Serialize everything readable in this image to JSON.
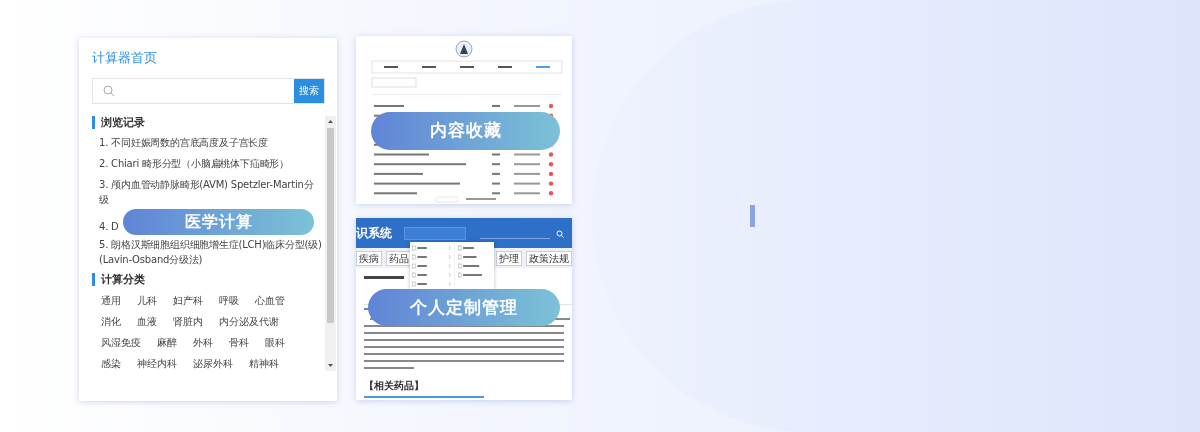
{
  "calculator_panel": {
    "title": "计算器首页",
    "search": {
      "button": "搜索"
    },
    "history": {
      "heading": "浏览记录",
      "items": [
        "1. 不同妊娠周数的宫底高度及子宫长度",
        "2. Chiari 畸形分型（小脑扁桃体下疝畸形）",
        "3. 颅内血管动静脉畸形(AVM) Spetzler-Martin分级",
        "4. D",
        "5. 朗格汉斯细胞组织细胞增生症(LCH)临床分型(级)(Lavin-Osband分级法)"
      ]
    },
    "categories": {
      "heading": "计算分类",
      "rows": [
        [
          "通用",
          "儿科",
          "妇产科",
          "呼吸",
          "心血管"
        ],
        [
          "消化",
          "血液",
          "肾脏内",
          "内分泌及代谢"
        ],
        [
          "风湿免疫",
          "麻醉",
          "外科",
          "骨科",
          "眼科"
        ],
        [
          "感染",
          "神经内科",
          "泌尿外科",
          "精神科"
        ]
      ]
    },
    "overlay_label": "医学计算"
  },
  "favorites_panel": {
    "overlay_label": "内容收藏"
  },
  "custom_panel": {
    "header_title": "识系统",
    "nav_left": [
      "疾病",
      "药品"
    ],
    "nav_right": [
      "护理",
      "政策法规"
    ],
    "section_heading": "【相关药品】",
    "overlay_label": "个人定制管理"
  }
}
